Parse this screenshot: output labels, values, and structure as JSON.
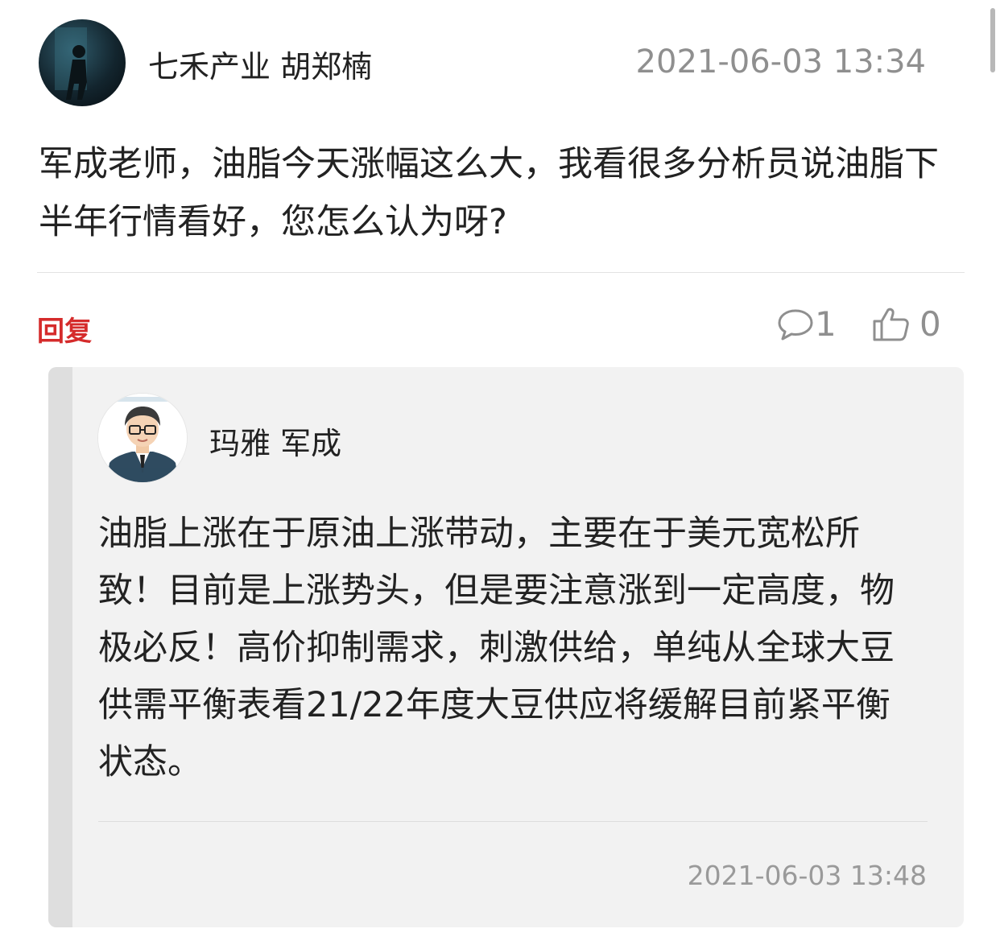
{
  "question": {
    "author": "七禾产业 胡郑楠",
    "timestamp": "2021-06-03 13:34",
    "text": "军成老师，油脂今天涨幅这么大，我看很多分析员说油脂下半年行情看好，您怎么认为呀?"
  },
  "actions": {
    "reply_label": "回复",
    "comment_count": "1",
    "like_count": "0",
    "comment_icon": "speech-bubble-icon",
    "like_icon": "thumbs-up-icon"
  },
  "reply": {
    "author": "玛雅 军成",
    "text": "油脂上涨在于原油上涨带动，主要在于美元宽松所致！目前是上涨势头，但是要注意涨到一定高度，物极必反！高价抑制需求，刺激供给，单纯从全球大豆供需平衡表看21/22年度大豆供应将缓解目前紧平衡状态。",
    "timestamp": "2021-06-03 13:48"
  },
  "colors": {
    "accent_red": "#d52b2b",
    "muted_gray": "#8f8f8f",
    "reply_bg": "#f2f2f2"
  }
}
